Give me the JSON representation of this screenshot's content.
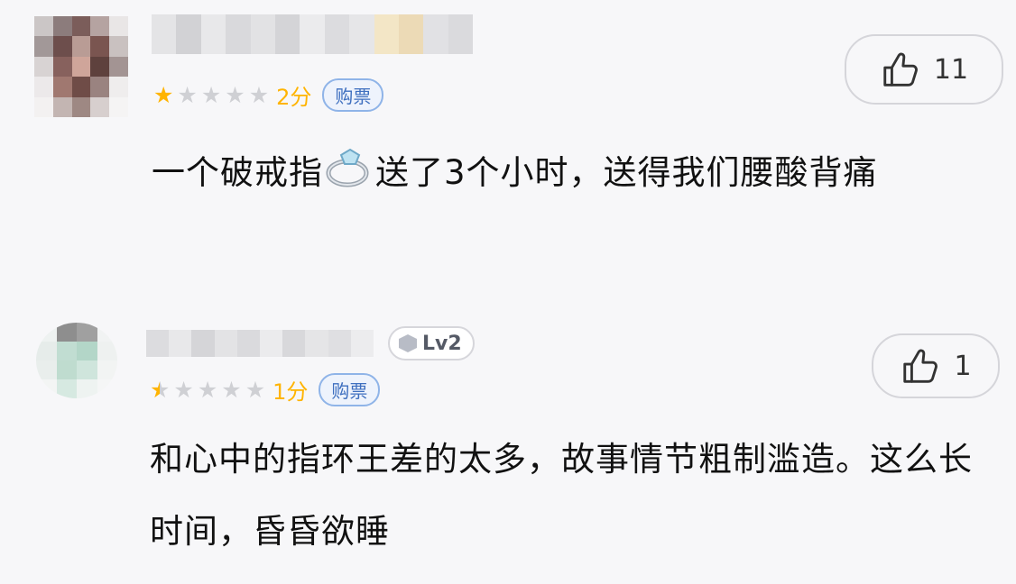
{
  "comments": [
    {
      "score_text": "2分",
      "ticket_label": "购票",
      "like_count": "11",
      "stars": [
        "on",
        "off",
        "off",
        "off",
        "off"
      ],
      "text_before_icon": "一个破戒指",
      "inline_icon": "ring-emoji",
      "text_after_icon": "送了3个小时，送得我们腰酸背痛"
    },
    {
      "level_badge": "Lv2",
      "score_text": "1分",
      "ticket_label": "购票",
      "like_count": "1",
      "stars": [
        "half",
        "off",
        "off",
        "off",
        "off"
      ],
      "text": "和心中的指环王差的太多，故事情节粗制滥造。这么长时间，昏昏欲睡"
    }
  ],
  "icons": {
    "like": "thumbs-up-icon",
    "star": "star-icon",
    "level": "hexagon-level-icon"
  },
  "colors": {
    "star_on": "#ffb400",
    "star_off": "#cfd0d4",
    "ticket_border": "#8fb4e8",
    "ticket_text": "#3e6fbf"
  }
}
